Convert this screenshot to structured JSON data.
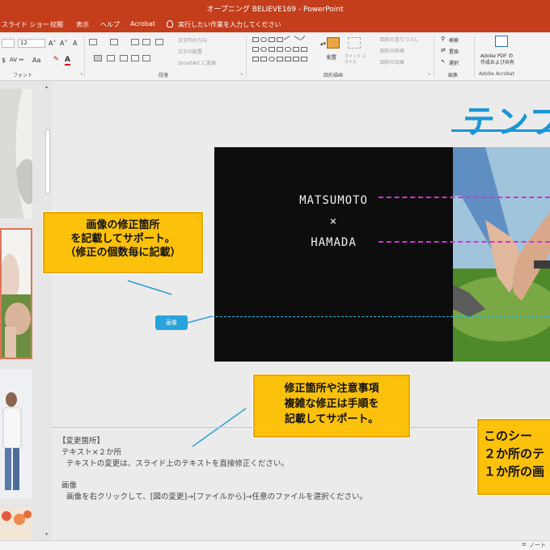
{
  "window": {
    "title": "オープニング BELIEVE169  -  PowerPoint"
  },
  "tabs": [
    {
      "label": "スライド ショー"
    },
    {
      "label": "校閲"
    },
    {
      "label": "表示"
    },
    {
      "label": "ヘルプ"
    },
    {
      "label": "Acrobat"
    }
  ],
  "tell_me": "実行したい作業を入力してください",
  "ribbon": {
    "font_size": "12",
    "groups": {
      "font": "フォント",
      "paragraph": "段落",
      "drawing": "図形描画",
      "editing": "編集",
      "acrobat": "Adobe Acrobat"
    },
    "paragraph_items": [
      "文字列の方向",
      "文字の配置",
      "SmartArt に変換"
    ],
    "drawing_items": {
      "arrange": "配置",
      "quick_styles": "クイック スタイル",
      "fill": "図形の塗りつぶし",
      "outline": "図形の枠線",
      "effects": "図形の効果"
    },
    "editing_items": [
      "検索",
      "置換",
      "選択"
    ],
    "acrobat_button": [
      "Adobe PDF の",
      "作成および共有"
    ]
  },
  "slide": {
    "title": "テンプ",
    "names": [
      "MATSUMOTO",
      "×",
      "HAMADA"
    ],
    "image_tag": "画像"
  },
  "callouts": {
    "image_note": [
      "画像の修正箇所",
      "を記載してサポート。",
      "（修正の個数毎に記載）"
    ],
    "edit_note": [
      "修正箇所や注意事項",
      "複雑な修正は手順を",
      "記載してサポート。"
    ],
    "right_note": [
      "このシー",
      "２か所のテ",
      "１か所の画"
    ]
  },
  "notes": {
    "heading": "【変更箇所】",
    "text_count": "テキスト×２か所",
    "text_instruction": "テキストの変更は、スライド上のテキストを直接修正ください。",
    "image_heading": "画像",
    "image_instruction": "画像を右クリックして、[図の変更]→[ファイルから]→任意のファイルを選択ください。"
  },
  "status": {
    "notes_button": "ノート"
  },
  "colors": {
    "accent": "#c43e1c",
    "callout": "#fbc10b",
    "title_blue": "#1a96d6",
    "pink_guide": "#d233d2",
    "cyan_guide": "#2fb3d9"
  }
}
